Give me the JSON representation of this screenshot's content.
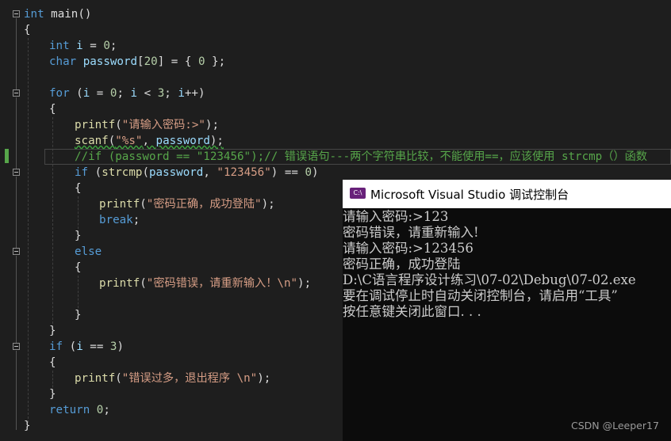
{
  "editor": {
    "lines": {
      "l1_kw": "int",
      "l1_rest": " main()",
      "l2": "{",
      "l3_kw": "int",
      "l3_id": " i",
      "l3_a": " = ",
      "l3_num": "0",
      "l3_b": ";",
      "l4_kw": "char",
      "l4_id": " password",
      "l4_a": "[",
      "l4_num1": "20",
      "l4_b": "] = { ",
      "l4_num2": "0",
      "l4_c": " };",
      "l5_kw": "for",
      "l5_a": " (",
      "l5_i1": "i",
      "l5_b": " = ",
      "l5_n1": "0",
      "l5_c": "; ",
      "l5_i2": "i",
      "l5_d": " < ",
      "l5_n2": "3",
      "l5_e": "; ",
      "l5_i3": "i",
      "l5_f": "++)",
      "l6": "{",
      "l7_fn": "printf",
      "l7_a": "(",
      "l7_str": "\"请输入密码:>\"",
      "l7_b": ");",
      "l8_fn": "scanf",
      "l8_a": "(",
      "l8_str": "\"%s\"",
      "l8_b": ", ",
      "l8_id": "password",
      "l8_c": ");",
      "l9_cm": "//if (password == \"123456\");// 错误语句---两个字符串比较，不能使用==，应该使用 strcmp（）函数",
      "l10_kw": "if",
      "l10_a": " (",
      "l10_fn": "strcmp",
      "l10_b": "(",
      "l10_id": "password",
      "l10_c": ", ",
      "l10_str": "\"123456\"",
      "l10_d": ") == ",
      "l10_num": "0",
      "l10_e": ")",
      "l11": "{",
      "l12_fn": "printf",
      "l12_a": "(",
      "l12_str": "\"密码正确，成功登陆\"",
      "l12_b": ");",
      "l13_kw": "break",
      "l13_a": ";",
      "l14": "}",
      "l15_kw": "else",
      "l16": "{",
      "l17_fn": "printf",
      "l17_a": "(",
      "l17_str": "\"密码错误，请重新输入！\\n\"",
      "l17_b": ");",
      "l18": "}",
      "l19": "}",
      "l20_kw": "if",
      "l20_a": " (",
      "l20_id": "i",
      "l20_b": " == ",
      "l20_num": "3",
      "l20_c": ")",
      "l21": "{",
      "l22_fn": "printf",
      "l22_a": "(",
      "l22_str": "\"错误过多，退出程序 \\n\"",
      "l22_b": ");",
      "l23": "}",
      "l24_kw": "return",
      "l24_a": " ",
      "l24_num": "0",
      "l24_b": ";",
      "l25": "}"
    }
  },
  "console": {
    "icon_text": "C:\\",
    "title": "Microsoft Visual Studio 调试控制台",
    "output": [
      "请输入密码:>123",
      "密码错误，请重新输入!",
      "请输入密码:>123456",
      "密码正确，成功登陆",
      "D:\\C语言程序设计练习\\07-02\\Debug\\07-02.exe",
      "要在调试停止时自动关闭控制台，请启用“工具”",
      "按任意键关闭此窗口. . ."
    ]
  },
  "watermark": "CSDN @Leeper17",
  "colors": {
    "keyword": "#569cd6",
    "identifier": "#9cdcfe",
    "function": "#dcdcaa",
    "string": "#d69d85",
    "number": "#b5cea8",
    "comment": "#57a64a",
    "editor_bg": "#1e1e1e",
    "console_bg": "#0c0c0c",
    "vs_purple": "#68217a"
  }
}
